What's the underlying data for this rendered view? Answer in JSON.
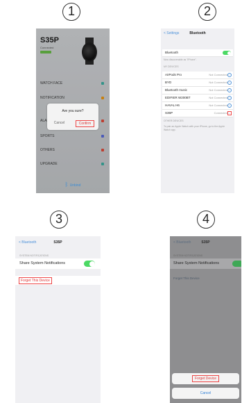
{
  "steps": [
    "1",
    "2",
    "3",
    "4"
  ],
  "panel1": {
    "device_name": "S35P",
    "subtitle": "Connected",
    "battery": "75%",
    "menu_items": [
      {
        "label": "WATCH FACE",
        "color": "#3fb4a8"
      },
      {
        "label": "NOTIFICATION",
        "color": "#f39c12"
      },
      {
        "label": "ALARM",
        "color": "#e74c3c"
      },
      {
        "label": "SPORTS",
        "color": "#5b6ee1"
      },
      {
        "label": "OTHERS",
        "color": "#e74c3c"
      },
      {
        "label": "UPGRADE",
        "color": "#3fb4a8"
      }
    ],
    "dialog": {
      "title": "Are you sure?",
      "cancel": "Cancel",
      "confirm": "Confirm"
    },
    "footer_icon": "bluetooth-icon",
    "footer_text": "Unbind"
  },
  "panel2": {
    "back": "< Settings",
    "title": "Bluetooth",
    "bluetooth_label": "Bluetooth",
    "discoverable_note": "Now discoverable as \"iPhone\".",
    "my_devices_header": "MY DEVICES",
    "devices": [
      {
        "name": "AirPods Pro",
        "status": "Not Connected"
      },
      {
        "name": "BYD",
        "status": "Not Connected"
      },
      {
        "name": "Bluetooth music",
        "status": "Not Connected"
      },
      {
        "name": "EDIFIER W200BT",
        "status": "Not Connected"
      },
      {
        "name": "HAVAL H6",
        "status": "Not Connected"
      },
      {
        "name": "S35P",
        "status": "Connected"
      }
    ],
    "other_header": "OTHER DEVICES",
    "footnote": "To pair an Apple Watch with your iPhone, go to the Apple Watch app."
  },
  "panel3": {
    "back": "< Bluetooth",
    "title": "S35P",
    "section": "SYSTEM NOTIFICATIONS",
    "share_label": "Share System Notifications",
    "forget_label": "Forget This Device"
  },
  "panel4": {
    "back": "< Bluetooth",
    "title": "S35P",
    "section": "SYSTEM NOTIFICATIONS",
    "share_label": "Share System Notifications",
    "forget_link": "Forget This Device",
    "forget_confirm": "Forget Device",
    "cancel": "Cancel"
  }
}
